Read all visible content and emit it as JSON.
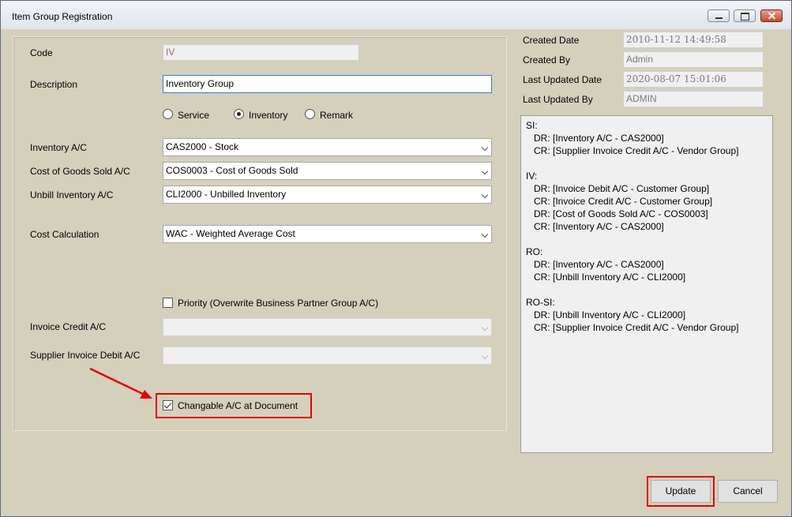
{
  "window": {
    "title": "Item Group Registration"
  },
  "form": {
    "code": {
      "label": "Code",
      "value": "IV"
    },
    "description": {
      "label": "Description",
      "value": "Inventory Group"
    },
    "type_options": [
      {
        "label": "Service",
        "selected": false
      },
      {
        "label": "Inventory",
        "selected": true
      },
      {
        "label": "Remark",
        "selected": false
      }
    ],
    "inventory_ac": {
      "label": "Inventory A/C",
      "value": "CAS2000 - Stock"
    },
    "cogs_ac": {
      "label": "Cost of Goods Sold A/C",
      "value": "COS0003 - Cost of Goods Sold"
    },
    "unbill_inventory_ac": {
      "label": "Unbill Inventory A/C",
      "value": "CLI2000 - Unbilled Inventory"
    },
    "cost_calculation": {
      "label": "Cost Calculation",
      "value": "WAC - Weighted Average Cost"
    },
    "priority": {
      "label": "Priority (Overwrite Business Partner Group A/C)",
      "checked": false
    },
    "invoice_credit_ac": {
      "label": "Invoice Credit A/C",
      "value": ""
    },
    "supplier_invoice_debit_ac": {
      "label": "Supplier Invoice Debit A/C",
      "value": ""
    },
    "changable_ac": {
      "label": "Changable A/C at Document",
      "checked": true
    }
  },
  "audit": {
    "created_date": {
      "label": "Created Date",
      "value": "2010-11-12 14:49:58"
    },
    "created_by": {
      "label": "Created By",
      "value": "Admin"
    },
    "last_updated_date": {
      "label": "Last Updated Date",
      "value": "2020-08-07 15:01:06"
    },
    "last_updated_by": {
      "label": "Last Updated By",
      "value": "ADMIN"
    }
  },
  "posting_info": "SI:\n   DR: [Inventory A/C - CAS2000]\n   CR: [Supplier Invoice Credit A/C - Vendor Group]\n\nIV:\n   DR: [Invoice Debit A/C - Customer Group]\n   CR: [Invoice Credit A/C - Customer Group]\n   DR: [Cost of Goods Sold A/C - COS0003]\n   CR: [Inventory A/C - CAS2000]\n\nRO:\n   DR: [Inventory A/C - CAS2000]\n   CR: [Unbill Inventory A/C - CLI2000]\n\nRO-SI:\n   DR: [Unbill Inventory A/C - CLI2000]\n   CR: [Supplier Invoice Credit A/C - Vendor Group]",
  "buttons": {
    "update": "Update",
    "cancel": "Cancel"
  },
  "annotation_color": "#e60000"
}
